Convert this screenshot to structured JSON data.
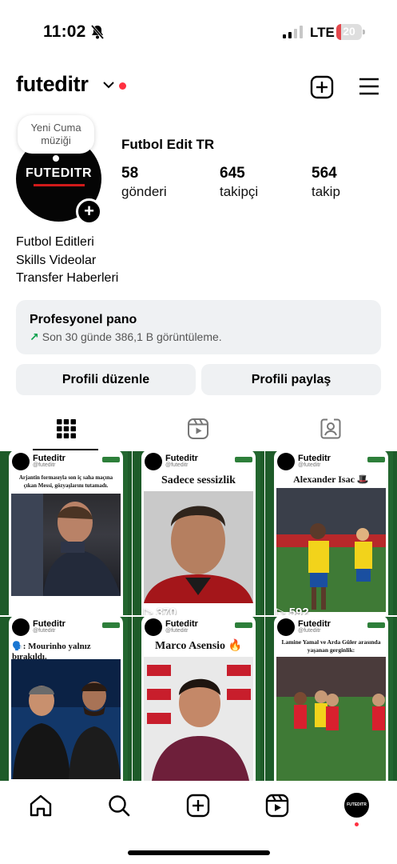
{
  "status_bar": {
    "time": "11:02",
    "network": "LTE",
    "battery": "20",
    "battery_percent": 20,
    "icons": [
      "bell-slash-icon",
      "signal-icon"
    ]
  },
  "header": {
    "username": "futeditr",
    "icons": [
      "chevron-down-icon",
      "create-post-icon",
      "menu-icon"
    ]
  },
  "profile": {
    "note": "Yeni Cuma müziği",
    "avatar_text": "FUTEDITR",
    "name": "Futbol Edit TR",
    "stats": [
      {
        "value": "58",
        "label": "gönderi"
      },
      {
        "value": "645",
        "label": "takipçi"
      },
      {
        "value": "564",
        "label": "takip"
      }
    ],
    "bio": [
      "Futbol Editleri",
      "Skills Videolar",
      "Transfer Haberleri"
    ]
  },
  "dashboard": {
    "title": "Profesyonel pano",
    "subtitle": "Son 30 günde 386,1 B görüntüleme."
  },
  "buttons": {
    "edit": "Profili düzenle",
    "share": "Profili paylaş"
  },
  "tabs": [
    "posts-grid-icon",
    "reels-icon",
    "tagged-icon"
  ],
  "posts": [
    {
      "account": "Futeditr",
      "handle": "@futeditr",
      "caption": "Arjantin formasıyla son iç saha maçına çıkan Messi, gözyaşlarını tutamadı.",
      "views": ""
    },
    {
      "account": "Futeditr",
      "handle": "@futeditr",
      "caption": "Sadece sessizlik",
      "views": "370"
    },
    {
      "account": "Futeditr",
      "handle": "@futeditr",
      "caption": "Alexander Isac 🎩",
      "views": "592"
    },
    {
      "account": "Futeditr",
      "handle": "@futeditr",
      "caption": "🗣️: Mourinho yalnız bırakıldı.",
      "views": ""
    },
    {
      "account": "Futeditr",
      "handle": "@futeditr",
      "caption": "Marco Asensio 🔥",
      "views": ""
    },
    {
      "account": "Futeditr",
      "handle": "@futeditr",
      "caption": "Lamine Yamal ve Arda Güler arasında yaşanan gerginlik:",
      "views": ""
    }
  ],
  "bottom_nav": [
    "home-icon",
    "search-icon",
    "create-icon",
    "reels-icon",
    "profile-avatar"
  ],
  "colors": {
    "accent_red": "#ff3040",
    "panel_grey": "#eff1f3",
    "growth_green": "#0aa04b"
  }
}
